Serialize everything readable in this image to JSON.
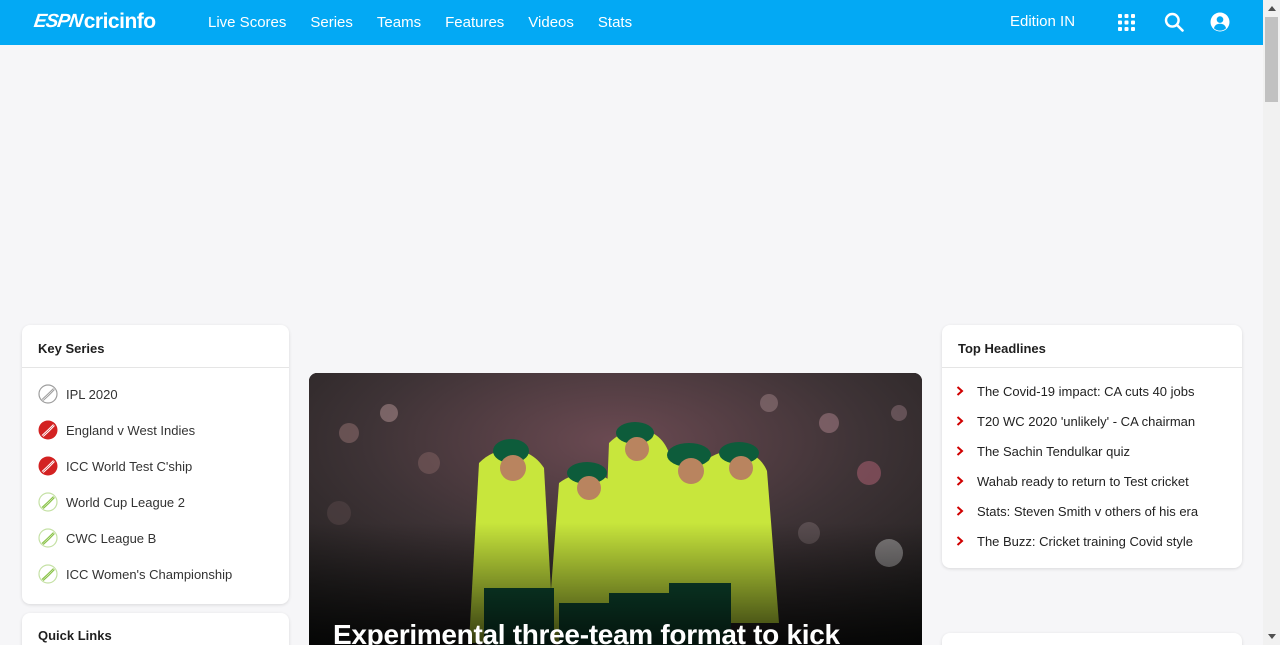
{
  "brand": {
    "logo_espn": "ESPN",
    "logo_site": "cricinfo"
  },
  "nav": {
    "items": [
      "Live Scores",
      "Series",
      "Teams",
      "Features",
      "Videos",
      "Stats"
    ],
    "edition": "Edition IN"
  },
  "icons": {
    "apps": "grid-icon",
    "search": "search-icon",
    "account": "user-icon"
  },
  "colors": {
    "topbar": "#03a9f4",
    "chevron": "#d00000",
    "ball_red": "#d32222",
    "ball_green": "#8bc34a"
  },
  "key_series": {
    "title": "Key Series",
    "items": [
      {
        "label": "IPL 2020",
        "ball": "grey"
      },
      {
        "label": "England v West Indies",
        "ball": "red"
      },
      {
        "label": "ICC World Test C'ship",
        "ball": "red"
      },
      {
        "label": "World Cup League 2",
        "ball": "green"
      },
      {
        "label": "CWC League B",
        "ball": "green"
      },
      {
        "label": "ICC Women's Championship",
        "ball": "green"
      }
    ]
  },
  "quick_links": {
    "title": "Quick Links"
  },
  "hero": {
    "title": "Experimental three-team format to kick"
  },
  "top_headlines": {
    "title": "Top Headlines",
    "items": [
      "The Covid-19 impact: CA cuts 40 jobs",
      "T20 WC 2020 'unlikely' - CA chairman",
      "The Sachin Tendulkar quiz",
      "Wahab ready to return to Test cricket",
      "Stats: Steven Smith v others of his era",
      "The Buzz: Cricket training Covid style"
    ]
  }
}
